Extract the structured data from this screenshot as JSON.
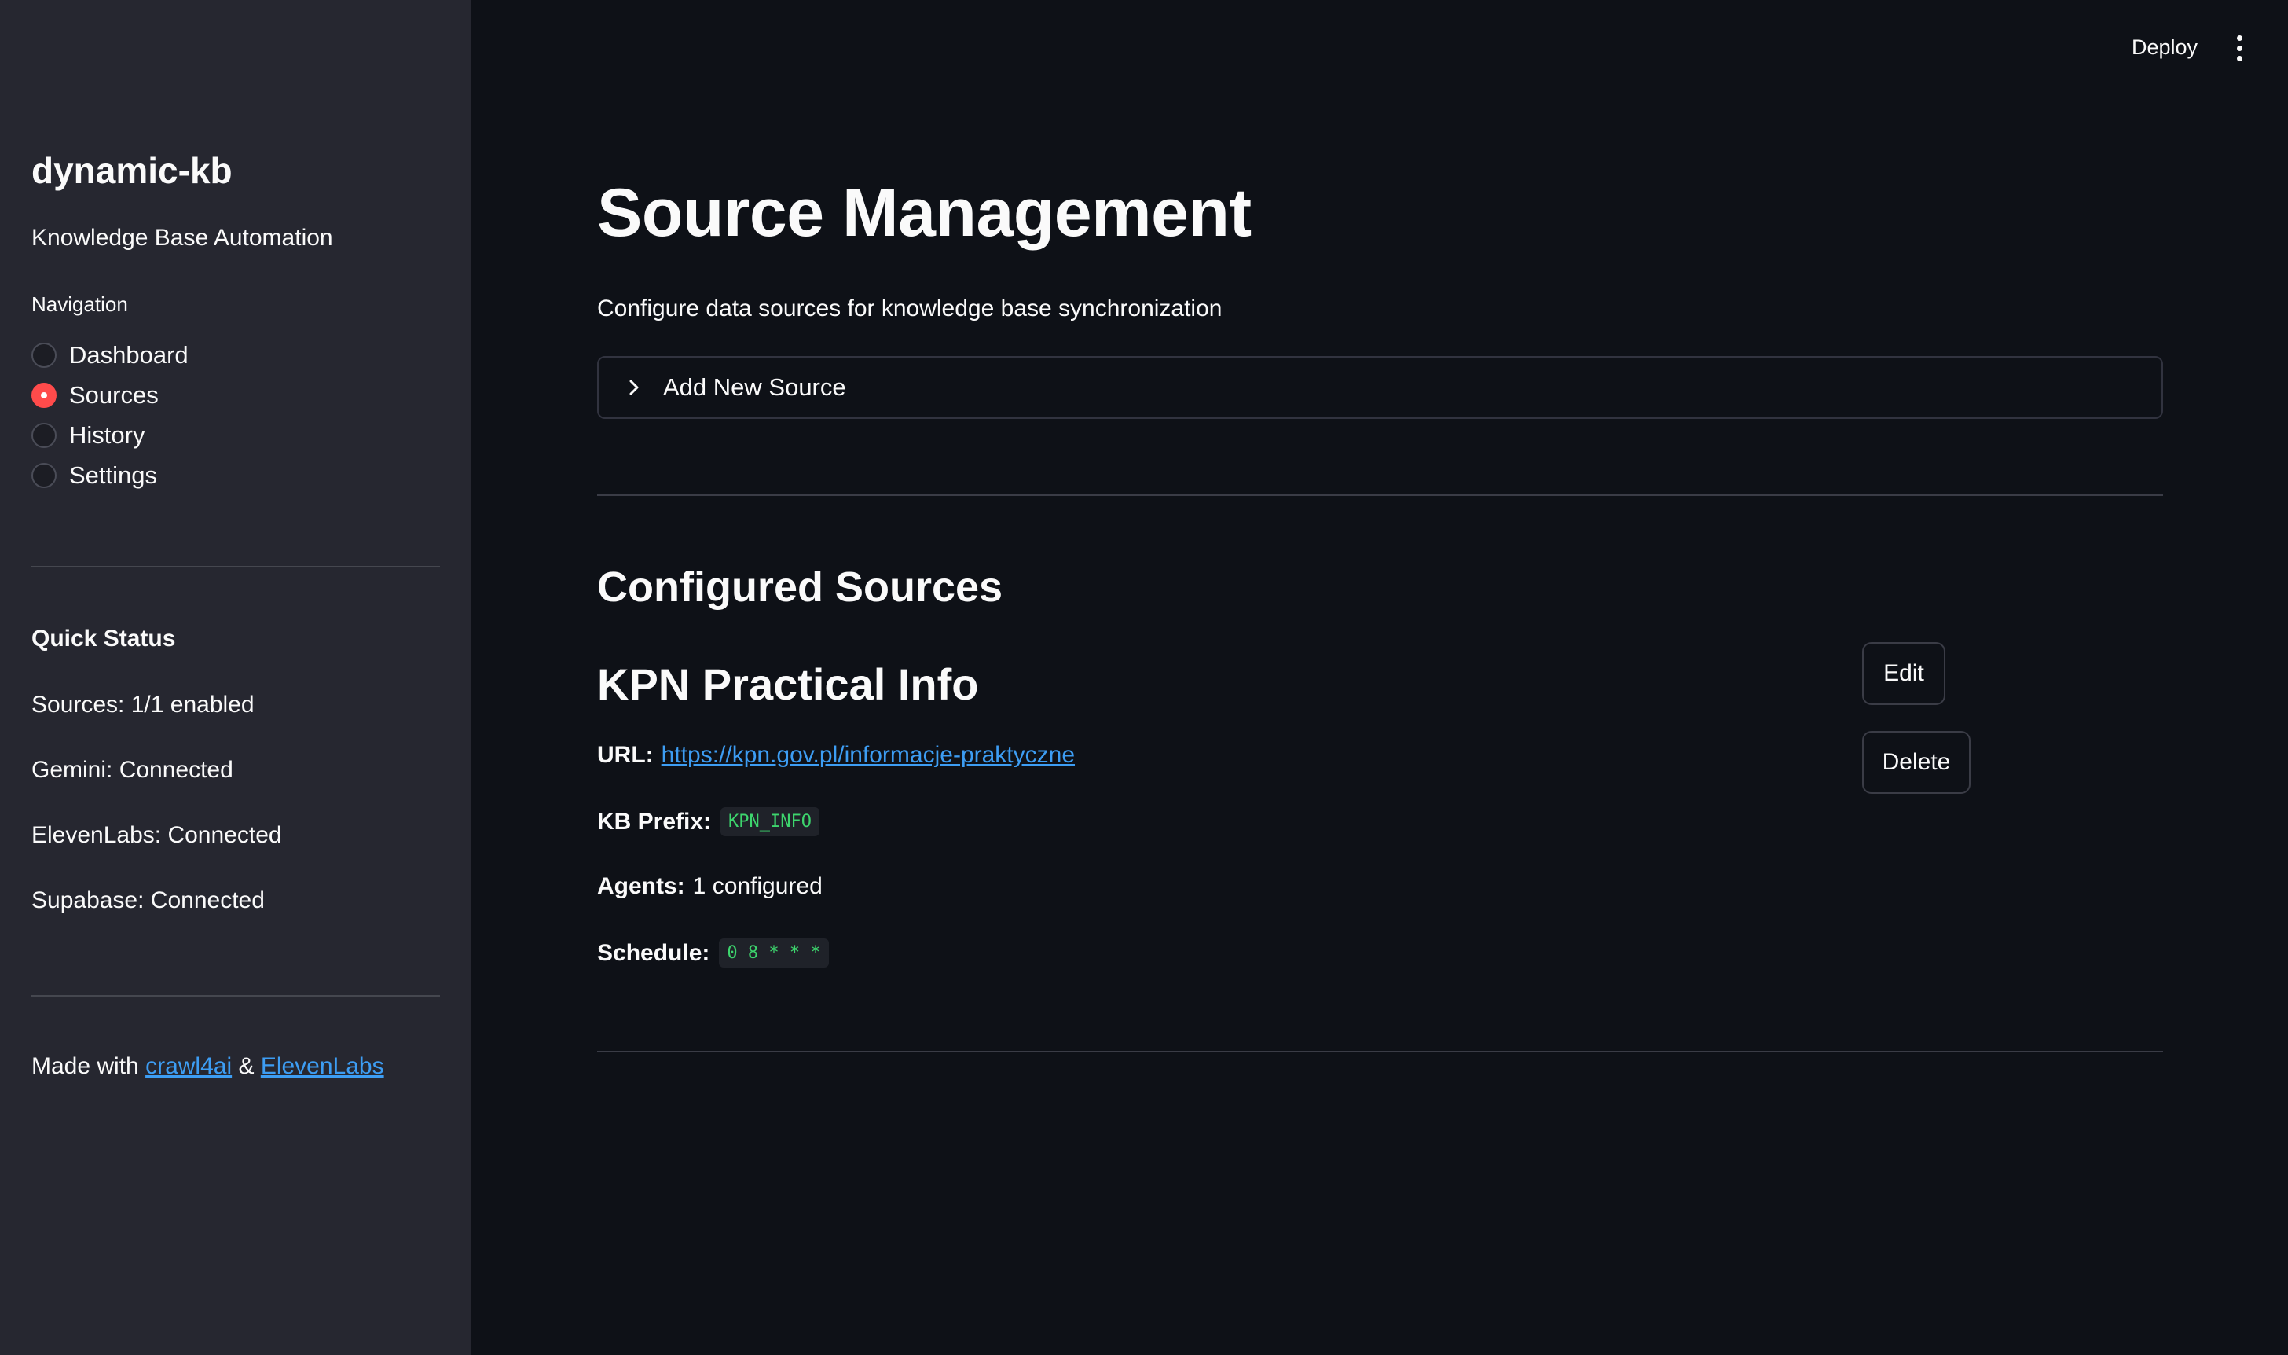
{
  "header": {
    "deploy_label": "Deploy",
    "menu_icon": "kebab-menu-icon"
  },
  "sidebar": {
    "title": "dynamic-kb",
    "subtitle": "Knowledge Base Automation",
    "nav_label": "Navigation",
    "nav_items": [
      {
        "label": "Dashboard",
        "selected": false
      },
      {
        "label": "Sources",
        "selected": true
      },
      {
        "label": "History",
        "selected": false
      },
      {
        "label": "Settings",
        "selected": false
      }
    ],
    "status_heading": "Quick Status",
    "status": [
      "Sources: 1/1 enabled",
      "Gemini: Connected",
      "ElevenLabs: Connected",
      "Supabase: Connected"
    ],
    "footer": {
      "prefix": "Made with ",
      "link1": "crawl4ai",
      "separator": " & ",
      "link2": "ElevenLabs"
    }
  },
  "main": {
    "title": "Source Management",
    "caption": "Configure data sources for knowledge base synchronization",
    "expander_label": "Add New Source",
    "section_title": "Configured Sources",
    "source": {
      "name": "KPN Practical Info",
      "url_label": "URL:",
      "url": "https://kpn.gov.pl/informacje-praktyczne",
      "prefix_label": "KB Prefix:",
      "prefix": "KPN_INFO",
      "agents_label": "Agents:",
      "agents": "1 configured",
      "schedule_label": "Schedule:",
      "schedule": "0 8 * * *",
      "edit_label": "Edit",
      "delete_label": "Delete"
    }
  },
  "colors": {
    "background": "#0e1117",
    "sidebar": "#262730",
    "accent": "#ff4b4b",
    "link": "#3d9df3",
    "code_text": "#3dd56d"
  }
}
